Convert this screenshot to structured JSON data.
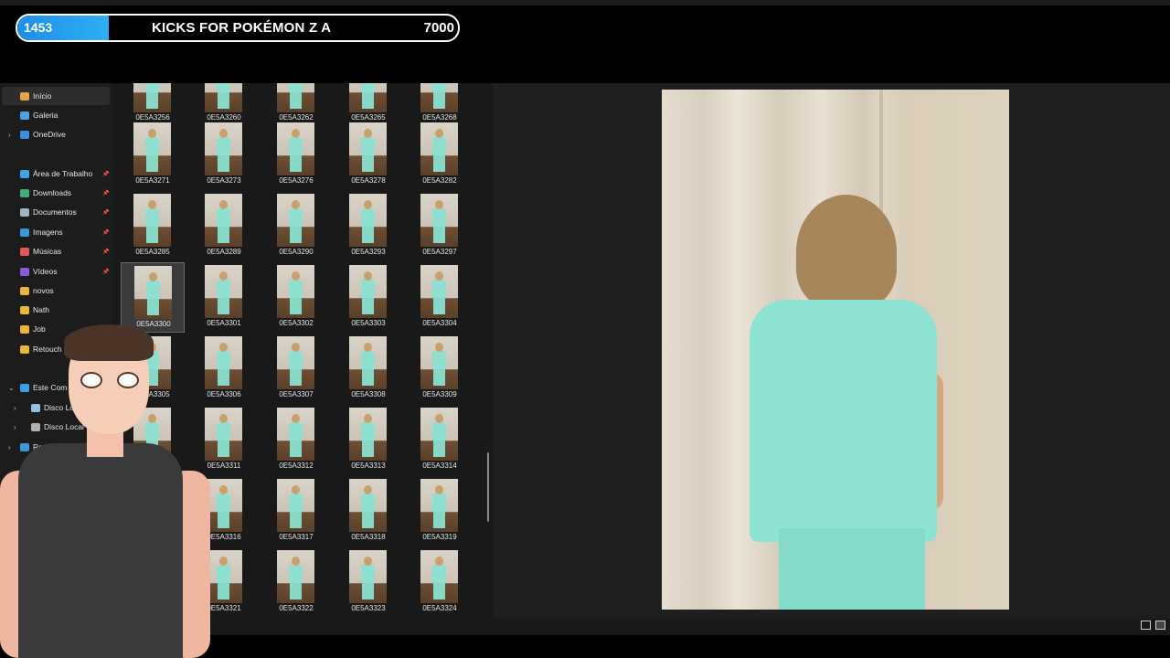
{
  "goal": {
    "current": "1453",
    "title": "KICKS FOR POKÉMON Z A",
    "target": "7000",
    "progress_fraction": 0.2076,
    "fill_color": "#2fa8f0"
  },
  "nav": {
    "items": [
      {
        "label": "Início",
        "icon": "home-icon",
        "color": "#e7a24a",
        "chev": "",
        "pin": false,
        "active": true,
        "indent": 0
      },
      {
        "label": "Galeria",
        "icon": "gallery-icon",
        "color": "#4aa3e6",
        "chev": "",
        "pin": false,
        "active": false,
        "indent": 0
      },
      {
        "label": "OneDrive",
        "icon": "cloud-icon",
        "color": "#3b8fe0",
        "chev": "›",
        "pin": false,
        "active": false,
        "indent": 0
      },
      {
        "label": "Área de Trabalho",
        "icon": "desktop-icon",
        "color": "#3ea6e8",
        "chev": "",
        "pin": true,
        "active": false,
        "indent": 0
      },
      {
        "label": "Downloads",
        "icon": "download-icon",
        "color": "#3fb07a",
        "chev": "",
        "pin": true,
        "active": false,
        "indent": 0
      },
      {
        "label": "Documentos",
        "icon": "document-icon",
        "color": "#9fb4c8",
        "chev": "",
        "pin": true,
        "active": false,
        "indent": 0
      },
      {
        "label": "Imagens",
        "icon": "image-icon",
        "color": "#3a9ad9",
        "chev": "",
        "pin": true,
        "active": false,
        "indent": 0
      },
      {
        "label": "Músicas",
        "icon": "music-icon",
        "color": "#e05a5a",
        "chev": "",
        "pin": true,
        "active": false,
        "indent": 0
      },
      {
        "label": "Vídeos",
        "icon": "video-icon",
        "color": "#8a5ad6",
        "chev": "",
        "pin": true,
        "active": false,
        "indent": 0
      },
      {
        "label": "novos",
        "icon": "folder-icon",
        "color": "#e8b63c",
        "chev": "",
        "pin": false,
        "active": false,
        "indent": 0
      },
      {
        "label": "Nath",
        "icon": "folder-icon",
        "color": "#e8b63c",
        "chev": "",
        "pin": false,
        "active": false,
        "indent": 0
      },
      {
        "label": "Job",
        "icon": "folder-icon",
        "color": "#e8b63c",
        "chev": "",
        "pin": false,
        "active": false,
        "indent": 0
      },
      {
        "label": "Retouch",
        "icon": "folder-icon",
        "color": "#e8b63c",
        "chev": "",
        "pin": false,
        "active": false,
        "indent": 0
      },
      {
        "label": "Este Com",
        "icon": "computer-icon",
        "color": "#3aa0e8",
        "chev": "⌄",
        "pin": false,
        "active": false,
        "indent": 0
      },
      {
        "label": "Disco Local",
        "icon": "disk-icon",
        "color": "#8fc0e8",
        "chev": "›",
        "pin": false,
        "active": false,
        "indent": 1
      },
      {
        "label": "Disco Local",
        "icon": "disk-icon",
        "color": "#b0b0b0",
        "chev": "›",
        "pin": false,
        "active": false,
        "indent": 1
      },
      {
        "label": "Rede",
        "icon": "network-icon",
        "color": "#3a9ad9",
        "chev": "›",
        "pin": false,
        "active": false,
        "indent": 0
      }
    ]
  },
  "files": [
    "0E5A3256",
    "0E5A3260",
    "0E5A3262",
    "0E5A3265",
    "0E5A3268",
    "0E5A3271",
    "0E5A3273",
    "0E5A3276",
    "0E5A3278",
    "0E5A3282",
    "0E5A3285",
    "0E5A3289",
    "0E5A3290",
    "0E5A3293",
    "0E5A3297",
    "0E5A3300",
    "0E5A3301",
    "0E5A3302",
    "0E5A3303",
    "0E5A3304",
    "0E5A3305",
    "0E5A3306",
    "0E5A3307",
    "0E5A3308",
    "0E5A3309",
    "",
    "0E5A3311",
    "0E5A3312",
    "0E5A3313",
    "0E5A3314",
    "",
    "0E5A3316",
    "0E5A3317",
    "0E5A3318",
    "0E5A3319",
    "",
    "0E5A3321",
    "0E5A3322",
    "0E5A3323",
    "0E5A3324"
  ],
  "selected_file": "0E5A3300",
  "status": {
    "view_details": "details-view-icon",
    "view_large": "large-icons-view-icon"
  }
}
